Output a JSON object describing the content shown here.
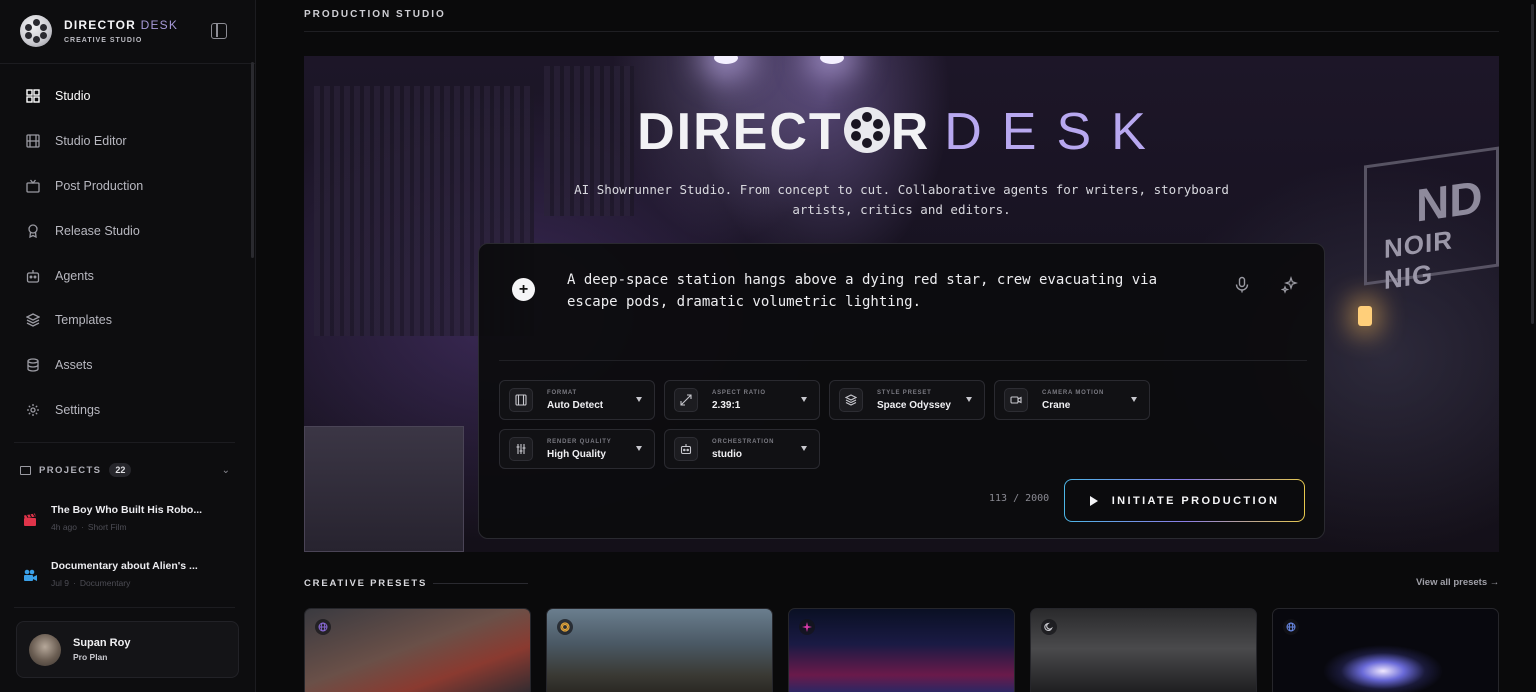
{
  "brand": {
    "name_bold": "DIRECTOR",
    "name_light": "DESK",
    "subtitle": "CREATIVE STUDIO"
  },
  "sidebar": {
    "items": [
      {
        "label": "Studio",
        "icon": "grid-icon",
        "active": true
      },
      {
        "label": "Studio Editor",
        "icon": "film-icon",
        "active": false
      },
      {
        "label": "Post Production",
        "icon": "tv-icon",
        "active": false
      },
      {
        "label": "Release Studio",
        "icon": "award-icon",
        "active": false
      },
      {
        "label": "Agents",
        "icon": "bot-icon",
        "active": false
      },
      {
        "label": "Templates",
        "icon": "layers-icon",
        "active": false
      },
      {
        "label": "Assets",
        "icon": "database-icon",
        "active": false
      },
      {
        "label": "Settings",
        "icon": "gear-icon",
        "active": false
      }
    ],
    "projects": {
      "title": "PROJECTS",
      "count": "22",
      "list": [
        {
          "title": "The Boy Who Built His Robo...",
          "time": "4h ago",
          "sep": "·",
          "genre": "Short Film",
          "icon": "clapperboard-icon",
          "color": "#e0344a"
        },
        {
          "title": "Documentary about Alien's ...",
          "time": "Jul 9",
          "sep": "·",
          "genre": "Documentary",
          "icon": "video-camera-icon",
          "color": "#3aa0e8"
        }
      ]
    },
    "user": {
      "name": "Supan Roy",
      "plan": "Pro Plan"
    }
  },
  "main": {
    "page_title": "PRODUCTION STUDIO",
    "hero": {
      "logo_bold_1": "DIRECT",
      "logo_bold_2": "R",
      "logo_light": "DESK",
      "subtitle": "AI Showrunner Studio. From concept to cut. Collaborative agents for writers, storyboard artists, critics and editors.",
      "sign_small": "NOIR NIG",
      "sign_big": "ND"
    },
    "composer": {
      "prompt": "A deep-space station hangs above a dying red star, crew evacuating via escape pods, dramatic volumetric lighting.",
      "options": [
        {
          "label": "FORMAT",
          "value": "Auto Detect",
          "icon": "film-icon"
        },
        {
          "label": "ASPECT RATIO",
          "value": "2.39:1",
          "icon": "expand-icon"
        },
        {
          "label": "STYLE PRESET",
          "value": "Space Odyssey",
          "icon": "layers-icon"
        },
        {
          "label": "CAMERA MOTION",
          "value": "Crane",
          "icon": "video-icon"
        },
        {
          "label": "RENDER QUALITY",
          "value": "High Quality",
          "icon": "sliders-icon"
        },
        {
          "label": "ORCHESTRATION",
          "value": "studio",
          "icon": "bot-icon"
        }
      ],
      "counter": "113 / 2000",
      "cta_label": "INITIATE PRODUCTION"
    },
    "presets": {
      "title": "CREATIVE PRESETS",
      "view_all": "View all presets →",
      "cards": [
        {
          "badge_icon": "globe-icon",
          "accent": "#8a6ad8"
        },
        {
          "badge_icon": "sun-icon",
          "accent": "#e8a83a"
        },
        {
          "badge_icon": "spark-icon",
          "accent": "#d83aa8"
        },
        {
          "badge_icon": "moon-icon",
          "accent": "#c8c8ce"
        },
        {
          "badge_icon": "globe-icon",
          "accent": "#6a8ae8"
        }
      ]
    }
  }
}
